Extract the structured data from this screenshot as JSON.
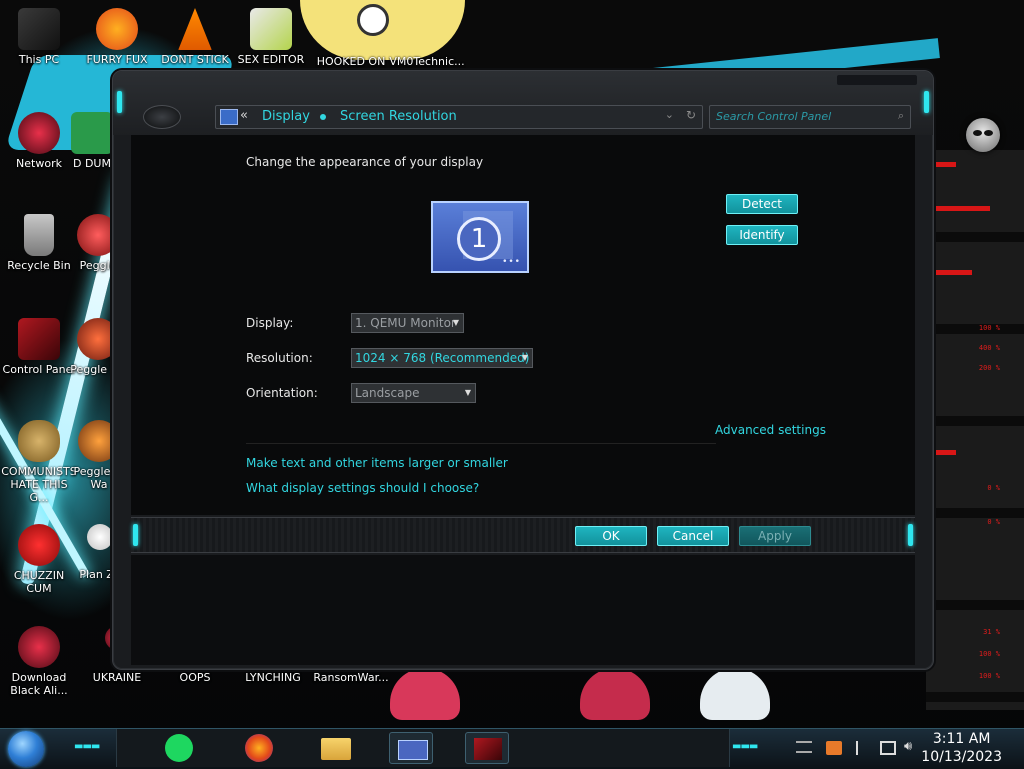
{
  "desktop": {
    "icons": [
      {
        "label": "This PC"
      },
      {
        "label": "FURRY FUX"
      },
      {
        "label": "DONT STICK"
      },
      {
        "label": "SEX EDITOR"
      },
      {
        "label": "HOOKED ON"
      },
      {
        "label": "VM0Technic..."
      },
      {
        "label": "Network"
      },
      {
        "label": "D DUM"
      },
      {
        "label": "Recycle Bin"
      },
      {
        "label": "Peggle"
      },
      {
        "label": "Control Panel"
      },
      {
        "label": "Peggle De"
      },
      {
        "label": "COMMUNISTS HATE THIS G..."
      },
      {
        "label": "Peggle of Wa"
      },
      {
        "label": "CHUZZIN CUM"
      },
      {
        "label": "Plan Zo"
      },
      {
        "label": "Download Black Ali..."
      },
      {
        "label": "UKRAINE"
      },
      {
        "label": "OOPS"
      },
      {
        "label": "LYNCHING"
      },
      {
        "label": "RansomWar..."
      }
    ],
    "side_readouts": [
      "100 %",
      "400 %",
      "200 %",
      "0 %",
      "0 %",
      "31 %",
      "100 %",
      "100 %"
    ]
  },
  "window": {
    "breadcrumb": [
      "Display",
      "Screen Resolution"
    ],
    "back_glyph": "«",
    "search_placeholder": "Search Control Panel",
    "heading": "Change the appearance of your display",
    "monitor_number": "1",
    "detect_label": "Detect",
    "identify_label": "Identify",
    "fields": {
      "display_label": "Display:",
      "display_value": "1. QEMU Monitor",
      "resolution_label": "Resolution:",
      "resolution_value": "1024 × 768 (Recommended)",
      "orientation_label": "Orientation:",
      "orientation_value": "Landscape"
    },
    "advanced_link": "Advanced settings",
    "link_text_size": "Make text and other items larger or smaller",
    "link_help": "What display settings should I choose?",
    "ok_label": "OK",
    "cancel_label": "Cancel",
    "apply_label": "Apply"
  },
  "taskbar": {
    "time": "3:11 AM",
    "date": "10/13/2023"
  },
  "colors": {
    "accent": "#32d6e0",
    "button": "#1fb5c0",
    "alert_red": "#e01c1c"
  }
}
